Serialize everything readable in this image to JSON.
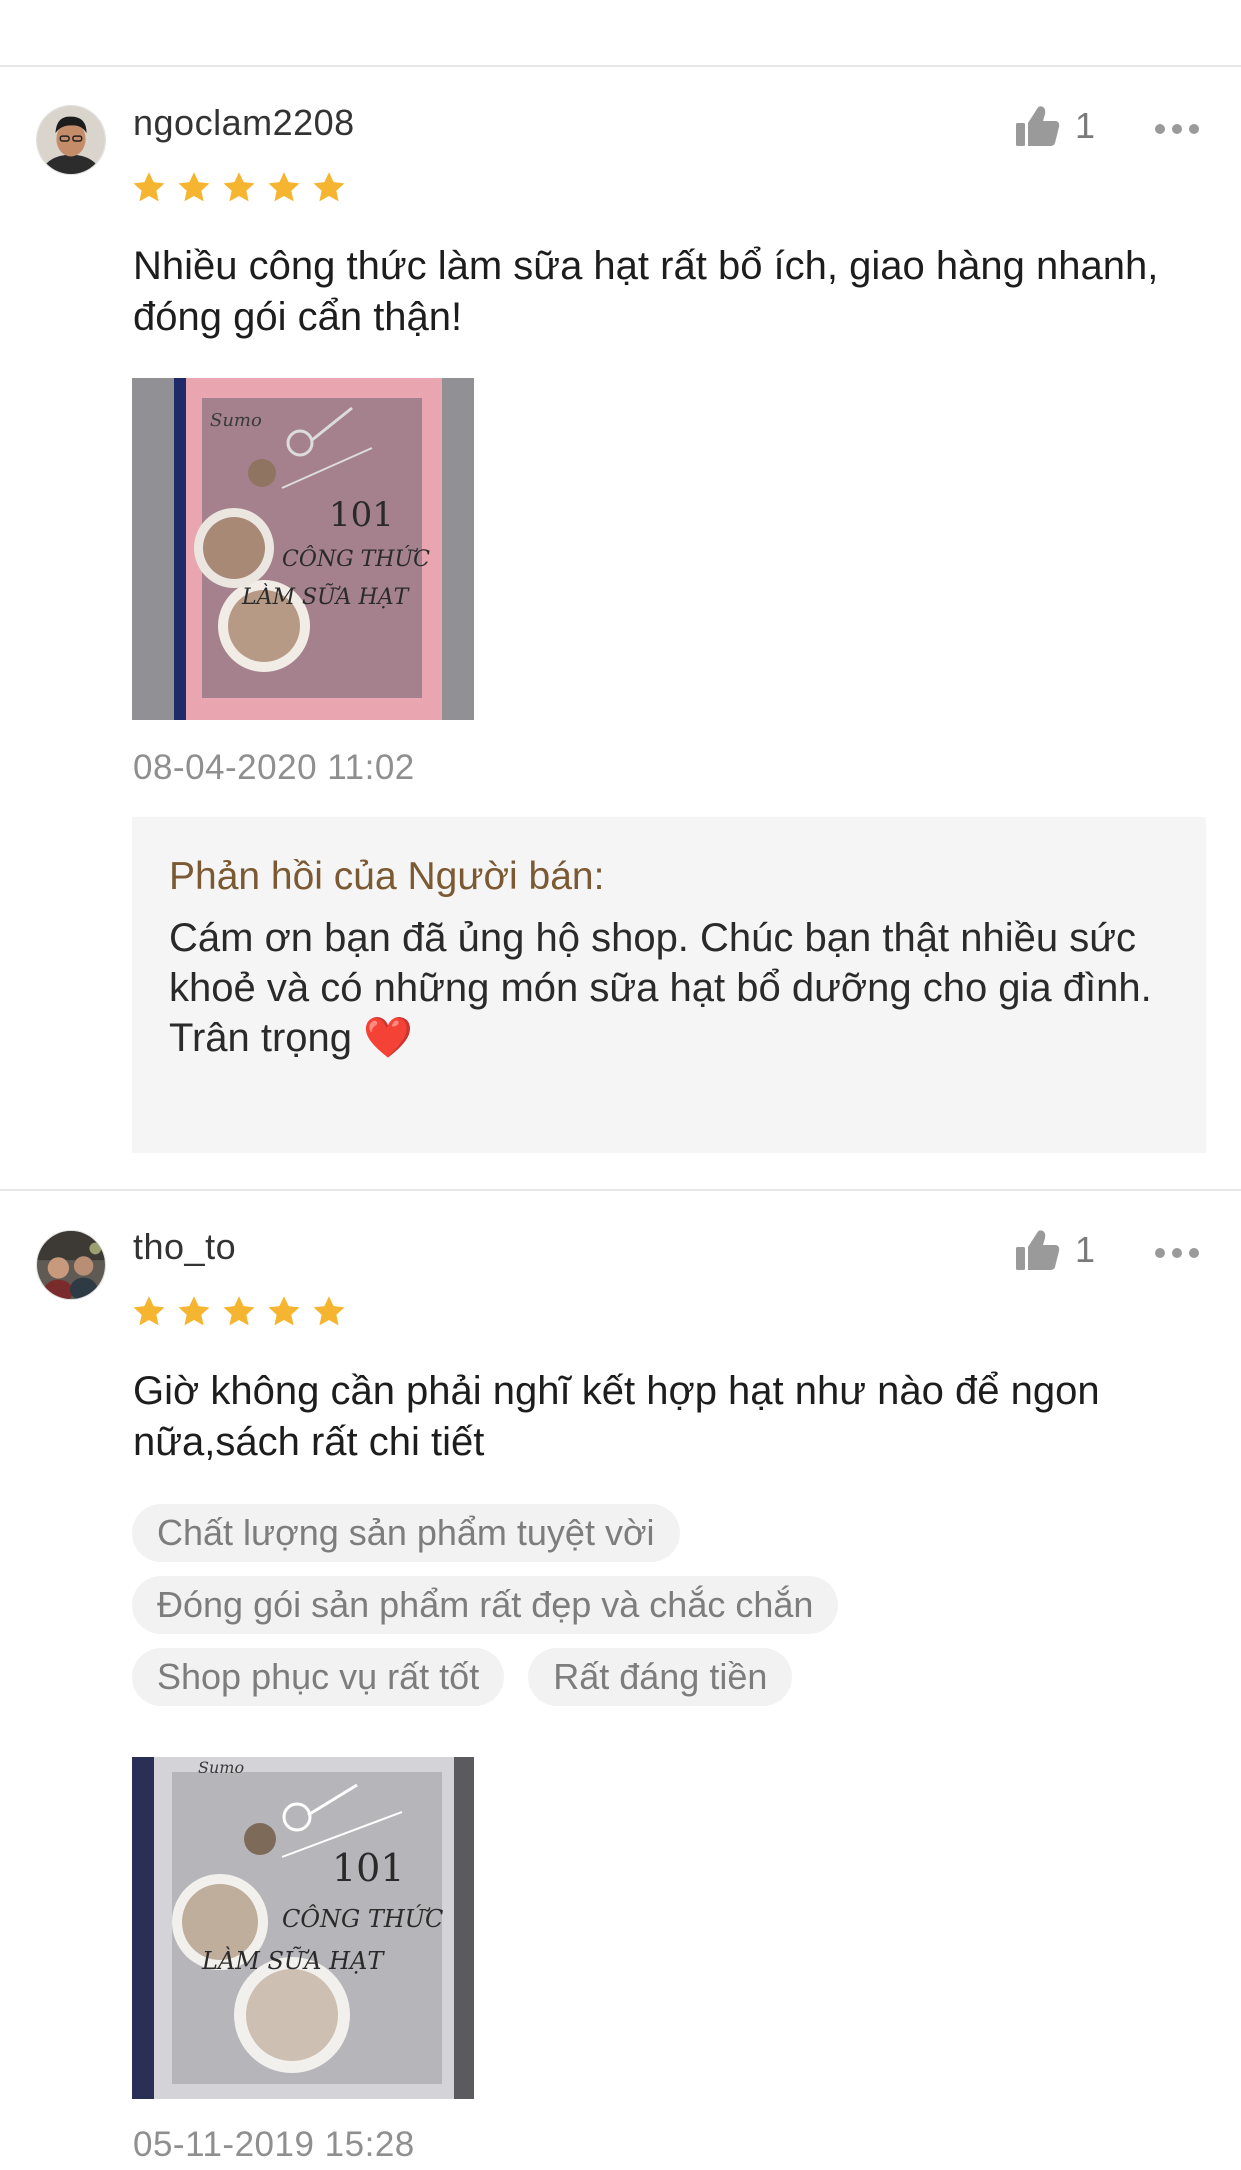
{
  "reviews": [
    {
      "username": "ngoclam2208",
      "rating": 5,
      "likes": "1",
      "comment": "Nhiều công thức làm sữa hạt rất bổ ích, giao hàng nhanh, đóng gói cẩn thận!",
      "timestamp": "08-04-2020 11:02",
      "seller_reply": {
        "title": "Phản hồi của Người bán:",
        "line1": "Cám ơn bạn đã ủng hộ shop. Chúc bạn thật nhiều sức khoẻ và có những món sữa hạt bổ dưỡng cho gia đình.",
        "line2": "Trân trọng",
        "emoji": "❤️"
      }
    },
    {
      "username": "tho_to",
      "rating": 5,
      "likes": "1",
      "comment": "Giờ không cần phải nghĩ kết hợp hạt như nào để ngon nữa,sách rất chi tiết",
      "tags": [
        "Chất lượng sản phẩm tuyệt vời",
        "Đóng gói sản phẩm rất đẹp và chắc chắn",
        "Shop phục vụ rất tốt",
        "Rất đáng tiền"
      ],
      "timestamp": "05-11-2019 15:28"
    }
  ],
  "colors": {
    "star": "#f6b530",
    "seller_reply_title": "#7b5a33",
    "reply_background": "#f5f5f5",
    "tag_background": "#f2f2f2"
  },
  "icons": {
    "like": "thumbs-up-icon",
    "more": "more-dots-icon",
    "star": "star-icon",
    "heart": "red-heart-emoji"
  }
}
